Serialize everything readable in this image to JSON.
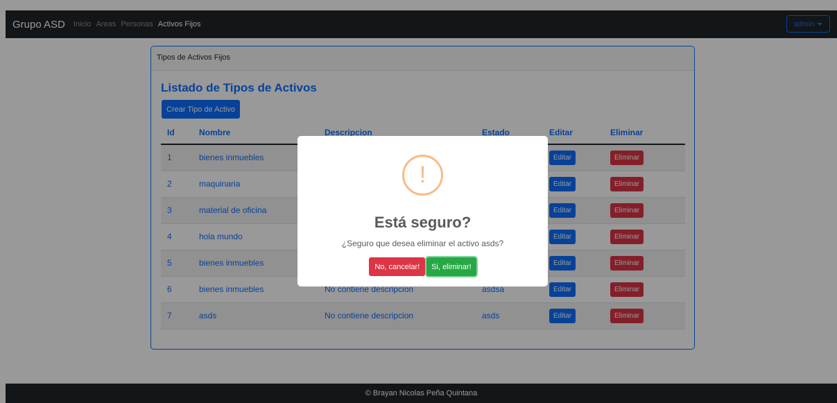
{
  "navbar": {
    "brand": "Grupo ASD",
    "links": [
      "Inicio",
      "Areas",
      "Personas",
      "Activos Fijos"
    ],
    "active_link": "Activos Fijos",
    "user_menu": "admin"
  },
  "card": {
    "header": "Tipos de Activos Fijos",
    "title": "Listado de Tipos de Activos",
    "create_button": "Crear Tipo de Activo"
  },
  "table": {
    "headers": [
      "Id",
      "Nombre",
      "Descripcion",
      "Estado",
      "Editar",
      "Eliminar"
    ],
    "rows": [
      {
        "id": "1",
        "nombre": "bienes inmuebles",
        "descripcion": "",
        "estado": "",
        "editar": "Editar",
        "eliminar": "Eliminar"
      },
      {
        "id": "2",
        "nombre": "maquinaria",
        "descripcion": "",
        "estado": "",
        "editar": "Editar",
        "eliminar": "Eliminar"
      },
      {
        "id": "3",
        "nombre": "material de oficina",
        "descripcion": "",
        "estado": "",
        "editar": "Editar",
        "eliminar": "Eliminar"
      },
      {
        "id": "4",
        "nombre": "hola mundo",
        "descripcion": "",
        "estado": "",
        "editar": "Editar",
        "eliminar": "Eliminar"
      },
      {
        "id": "5",
        "nombre": "bienes inmuebles",
        "descripcion": "",
        "estado": "",
        "editar": "Editar",
        "eliminar": "Eliminar"
      },
      {
        "id": "6",
        "nombre": "bienes inmuebles",
        "descripcion": "No contiene descripcion",
        "estado": "asdsa",
        "editar": "Editar",
        "eliminar": "Eliminar"
      },
      {
        "id": "7",
        "nombre": "asds",
        "descripcion": "No contiene descripcion",
        "estado": "asds",
        "editar": "Editar",
        "eliminar": "Eliminar"
      }
    ]
  },
  "footer": {
    "text": "© Brayan Nicolas Peña Quintana"
  },
  "modal": {
    "icon": "!",
    "title": "Está seguro?",
    "text": "¿Seguro que desea eliminar el activo asds?",
    "cancel_button": "No, cancelar!",
    "confirm_button": "Si, eliminar!"
  },
  "colors": {
    "primary": "#0d6efd",
    "danger": "#dc3545",
    "success": "#28a745",
    "warning_icon": "#f8bb86",
    "navbar": "#212529"
  }
}
